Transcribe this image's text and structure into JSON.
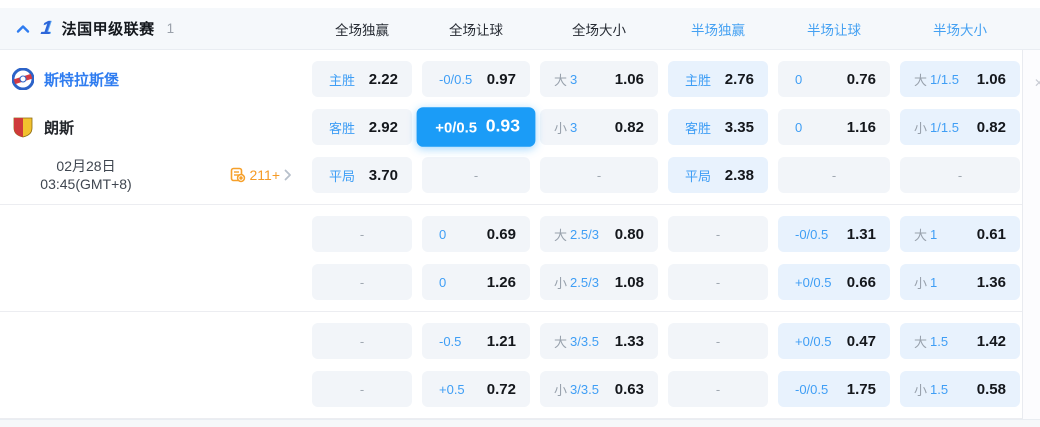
{
  "header": {
    "league": {
      "name": "法国甲级联赛",
      "count": "1"
    },
    "columns": [
      {
        "label": "全场独赢"
      },
      {
        "label": "全场让球"
      },
      {
        "label": "全场大小"
      },
      {
        "label": "半场独赢"
      },
      {
        "label": "半场让球"
      },
      {
        "label": "半场大小"
      }
    ]
  },
  "match": {
    "home_team": "斯特拉斯堡",
    "away_team": "朗斯",
    "date": "02月28日",
    "time": "03:45(GMT+8)",
    "markets_count": "211+"
  },
  "colors": {
    "accent_selected": "#1b9cf7",
    "label_blue": "#3f9ef5",
    "tint_cell_bg": "#e8f2fd",
    "cell_bg": "#f2f5f9",
    "markets_orange": "#f59b25",
    "home_team_blue": "#2e7cf0"
  },
  "odds_blocks": [
    {
      "rows": [
        {
          "cells": [
            {
              "l1": "",
              "l2": "主胜",
              "value": "2.22",
              "state": "normal"
            },
            {
              "l1": "",
              "l2": "-0/0.5",
              "value": "0.97",
              "state": "normal"
            },
            {
              "l1": "大",
              "l2": "3",
              "value": "1.06",
              "state": "normal"
            },
            {
              "l1": "",
              "l2": "主胜",
              "value": "2.76",
              "state": "tinted"
            },
            {
              "l1": "",
              "l2": "0",
              "value": "0.76",
              "state": "normal"
            },
            {
              "l1": "大",
              "l2": "1/1.5",
              "value": "1.06",
              "state": "tinted"
            }
          ]
        },
        {
          "cells": [
            {
              "l1": "",
              "l2": "客胜",
              "value": "2.92",
              "state": "normal"
            },
            {
              "l1": "",
              "l2": "+0/0.5",
              "value": "0.93",
              "state": "selected"
            },
            {
              "l1": "小",
              "l2": "3",
              "value": "0.82",
              "state": "normal"
            },
            {
              "l1": "",
              "l2": "客胜",
              "value": "3.35",
              "state": "tinted"
            },
            {
              "l1": "",
              "l2": "0",
              "value": "1.16",
              "state": "normal"
            },
            {
              "l1": "小",
              "l2": "1/1.5",
              "value": "0.82",
              "state": "tinted"
            }
          ]
        },
        {
          "cells": [
            {
              "l1": "",
              "l2": "平局",
              "value": "3.70",
              "state": "normal"
            },
            {
              "l1": "",
              "l2": "",
              "value": "-",
              "state": "empty"
            },
            {
              "l1": "",
              "l2": "",
              "value": "-",
              "state": "empty"
            },
            {
              "l1": "",
              "l2": "平局",
              "value": "2.38",
              "state": "tinted"
            },
            {
              "l1": "",
              "l2": "",
              "value": "-",
              "state": "empty"
            },
            {
              "l1": "",
              "l2": "",
              "value": "-",
              "state": "empty"
            }
          ]
        }
      ]
    },
    {
      "rows": [
        {
          "cells": [
            {
              "l1": "",
              "l2": "",
              "value": "-",
              "state": "empty"
            },
            {
              "l1": "",
              "l2": "0",
              "value": "0.69",
              "state": "normal"
            },
            {
              "l1": "大",
              "l2": "2.5/3",
              "value": "0.80",
              "state": "normal"
            },
            {
              "l1": "",
              "l2": "",
              "value": "-",
              "state": "empty"
            },
            {
              "l1": "",
              "l2": "-0/0.5",
              "value": "1.31",
              "state": "tinted"
            },
            {
              "l1": "大",
              "l2": "1",
              "value": "0.61",
              "state": "tinted"
            }
          ]
        },
        {
          "cells": [
            {
              "l1": "",
              "l2": "",
              "value": "-",
              "state": "empty"
            },
            {
              "l1": "",
              "l2": "0",
              "value": "1.26",
              "state": "normal"
            },
            {
              "l1": "小",
              "l2": "2.5/3",
              "value": "1.08",
              "state": "normal"
            },
            {
              "l1": "",
              "l2": "",
              "value": "-",
              "state": "empty"
            },
            {
              "l1": "",
              "l2": "+0/0.5",
              "value": "0.66",
              "state": "tinted"
            },
            {
              "l1": "小",
              "l2": "1",
              "value": "1.36",
              "state": "tinted"
            }
          ]
        }
      ]
    },
    {
      "rows": [
        {
          "cells": [
            {
              "l1": "",
              "l2": "",
              "value": "-",
              "state": "empty"
            },
            {
              "l1": "",
              "l2": "-0.5",
              "value": "1.21",
              "state": "normal"
            },
            {
              "l1": "大",
              "l2": "3/3.5",
              "value": "1.33",
              "state": "normal"
            },
            {
              "l1": "",
              "l2": "",
              "value": "-",
              "state": "empty"
            },
            {
              "l1": "",
              "l2": "+0/0.5",
              "value": "0.47",
              "state": "tinted"
            },
            {
              "l1": "大",
              "l2": "1.5",
              "value": "1.42",
              "state": "tinted"
            }
          ]
        },
        {
          "cells": [
            {
              "l1": "",
              "l2": "",
              "value": "-",
              "state": "empty"
            },
            {
              "l1": "",
              "l2": "+0.5",
              "value": "0.72",
              "state": "normal"
            },
            {
              "l1": "小",
              "l2": "3/3.5",
              "value": "0.63",
              "state": "normal"
            },
            {
              "l1": "",
              "l2": "",
              "value": "-",
              "state": "empty"
            },
            {
              "l1": "",
              "l2": "-0/0.5",
              "value": "1.75",
              "state": "tinted"
            },
            {
              "l1": "小",
              "l2": "1.5",
              "value": "0.58",
              "state": "tinted"
            }
          ]
        }
      ]
    }
  ]
}
